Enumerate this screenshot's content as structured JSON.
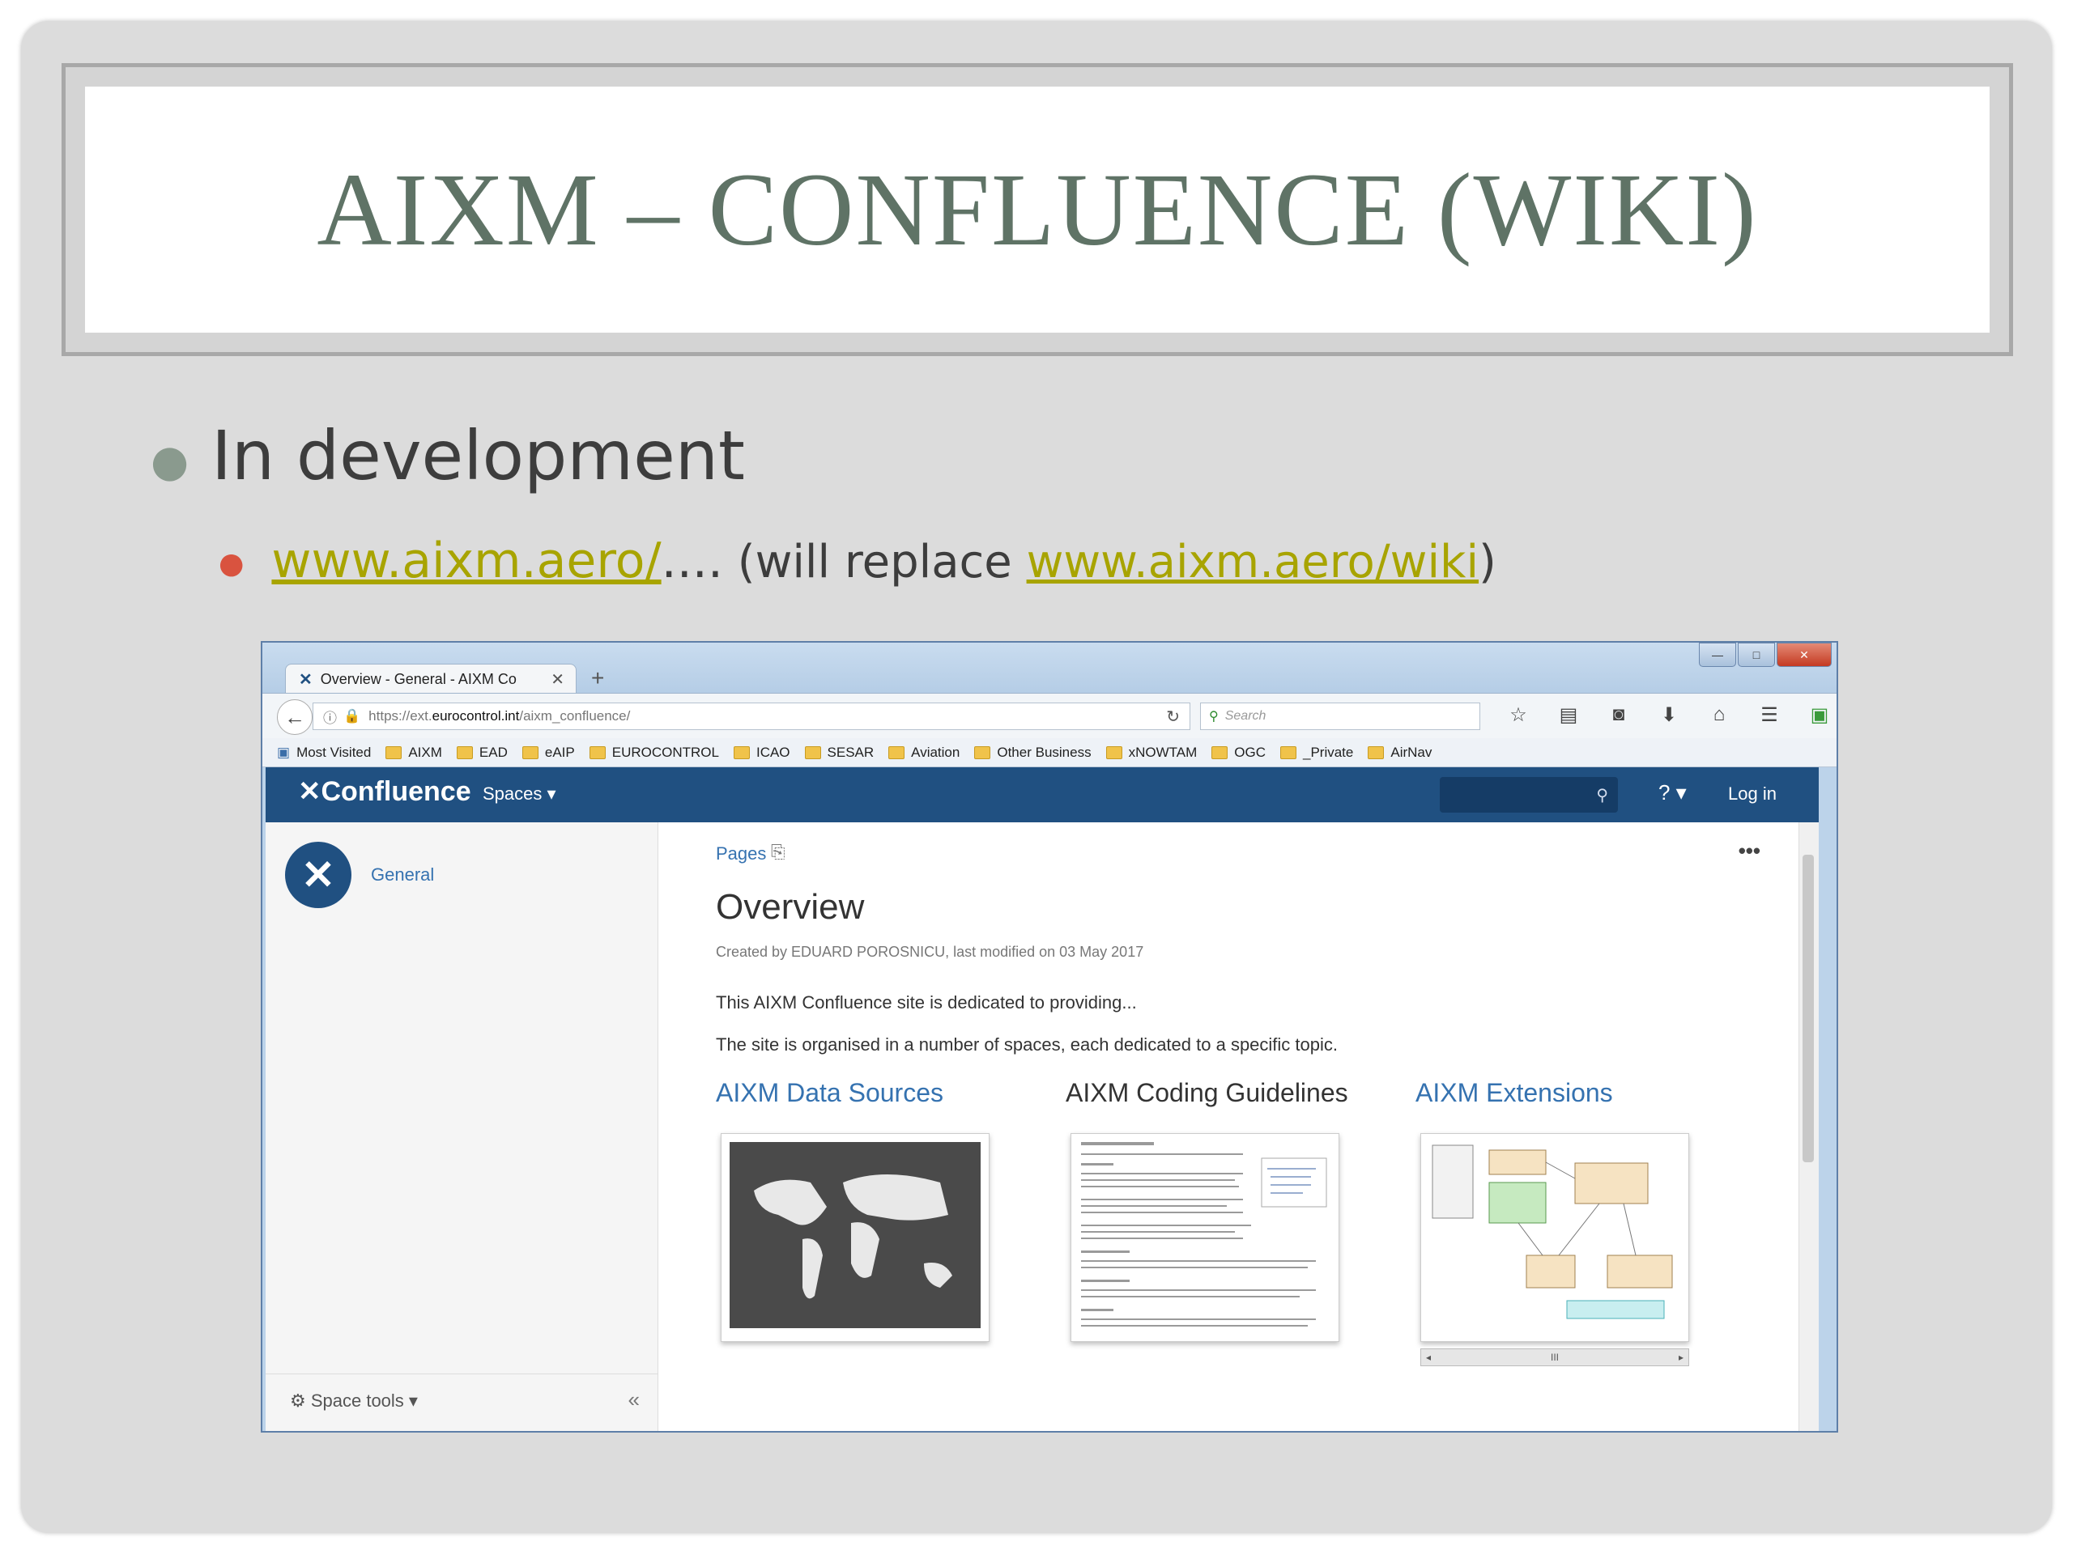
{
  "slide": {
    "title": "AIXM – CONFLUENCE (WIKI)",
    "bullet1": "In development",
    "bullet2_link": "www.aixm.aero/",
    "bullet2_dots": "....",
    "bullet2_paren_open": " (will replace ",
    "bullet2_link2": "www.aixm.aero/wiki",
    "bullet2_paren_close": ")"
  },
  "browser": {
    "tab_title": "Overview - General - AIXM Co",
    "tab_close": "✕",
    "new_tab": "+",
    "url_prefix": "https://ext.",
    "url_host": "eurocontrol.int",
    "url_path": "/aixm_confluence/",
    "search_placeholder": "Search",
    "window_buttons": [
      "—",
      "□",
      "✕"
    ],
    "bookmarks": [
      {
        "label": "Most Visited"
      },
      {
        "label": "AIXM"
      },
      {
        "label": "EAD"
      },
      {
        "label": "eAIP"
      },
      {
        "label": "EUROCONTROL"
      },
      {
        "label": "ICAO"
      },
      {
        "label": "SESAR"
      },
      {
        "label": "Aviation"
      },
      {
        "label": "Other Business"
      },
      {
        "label": "xNOWTAM"
      },
      {
        "label": "OGC"
      },
      {
        "label": "_Private"
      },
      {
        "label": "AirNav"
      }
    ]
  },
  "confluence": {
    "logo": "Confluence",
    "spaces_menu": "Spaces ▾",
    "help_menu": "? ▾",
    "login": "Log in",
    "space_name": "General",
    "space_tools": "Space tools ▾",
    "collapse": "«",
    "breadcrumb": "Pages",
    "page_title": "Overview",
    "byline": "Created by EDUARD POROSNICU, last modified on 03 May 2017",
    "para1": "This AIXM Confluence site is dedicated to providing...",
    "para2": "The site is organised in a number of spaces, each dedicated to a specific topic.",
    "columns": [
      {
        "title": "AIXM Data Sources"
      },
      {
        "title": "AIXM Coding Guidelines"
      },
      {
        "title": "AIXM Extensions"
      }
    ],
    "more": "•••",
    "hscroll_mid": "III"
  },
  "colors": {
    "title_text": "#5f7366",
    "link": "#a8a400",
    "confluence_blue": "#205081",
    "confluence_link": "#3572b0",
    "bullet_red": "#d9533f"
  }
}
